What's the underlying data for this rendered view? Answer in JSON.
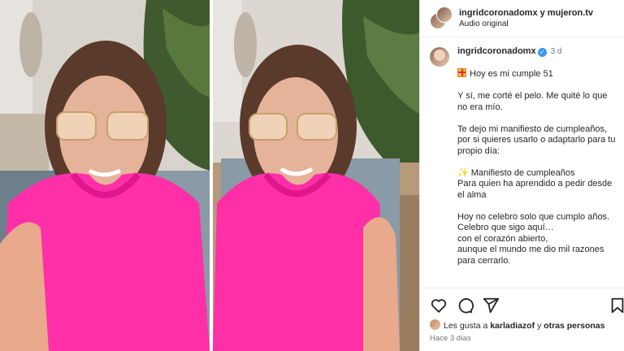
{
  "header": {
    "username": "ingridcoronadomx",
    "connector": " y ",
    "collaborator": "mujeron.tv",
    "audio": "Audio original"
  },
  "caption": {
    "username": "ingridcoronadomx",
    "time": "3 d",
    "paragraphs": [
      [
        "Hoy es mi cumple 51"
      ],
      [
        "Y sí, me corté el pelo. Me quité lo que",
        "no era mío."
      ],
      [
        "Te dejo mi manifiesto de cumpleaños,",
        "por si quieres usarlo o adaptarlo para tu",
        "propio día:"
      ],
      [
        "Manifiesto de cumpleaños",
        "Para quien ha aprendido a pedir desde",
        "el alma"
      ],
      [
        "Hoy no celebro solo que cumplo años.",
        "Celebro que sigo aquí…",
        "con el corazón abierto,",
        "aunque el mundo me dio mil razones",
        "para cerrarlo."
      ]
    ]
  },
  "likes": {
    "prefix": "Les gusta a ",
    "user": "karladiazof",
    "middle": " y ",
    "others": "otras personas"
  },
  "timestamp": "Hace 3 días",
  "icons": {
    "like": "heart-icon",
    "comment": "comment-icon",
    "share": "share-icon",
    "save": "bookmark-icon",
    "verified": "verified-badge-icon",
    "gift": "gift-emoji-icon",
    "sparkle": "sparkles-emoji-icon"
  },
  "colors": {
    "blouse": "#ff2fa8",
    "verified": "#3897f0",
    "muted_text": "#737373"
  }
}
